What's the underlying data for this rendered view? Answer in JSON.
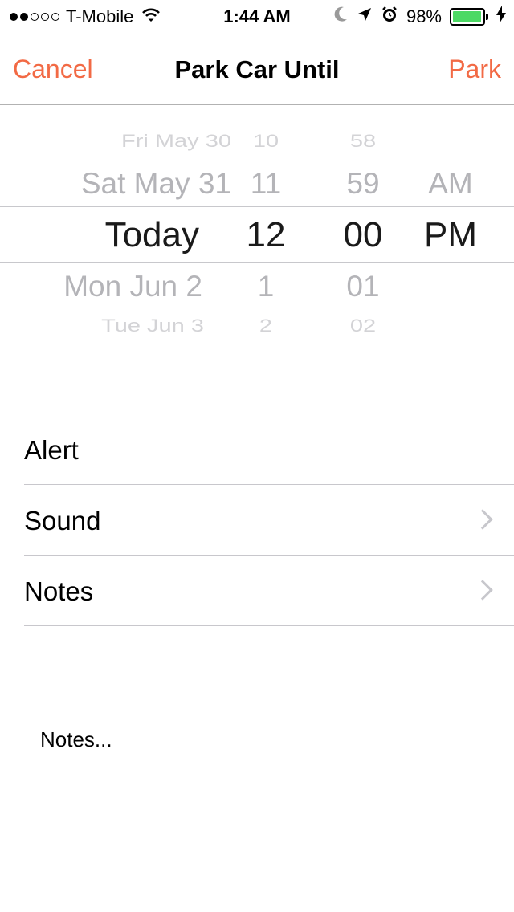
{
  "status_bar": {
    "carrier": "T-Mobile",
    "time": "1:44 AM",
    "battery_percent": "98%",
    "battery_level": 0.98,
    "signal_bars_filled": 2,
    "signal_bars_total": 5,
    "icons": [
      "wifi-icon",
      "moon-icon",
      "location-arrow-icon",
      "alarm-icon",
      "battery-icon",
      "charging-bolt-icon"
    ],
    "battery_color": "#4cd964"
  },
  "nav": {
    "cancel_label": "Cancel",
    "title": "Park Car Until",
    "park_label": "Park",
    "accent_color": "#f26a45"
  },
  "picker": {
    "dates": [
      "Fri May 30",
      "Sat May 31",
      "Today",
      "Mon Jun 2",
      "Tue Jun 3"
    ],
    "hours": [
      "10",
      "11",
      "12",
      "1",
      "2"
    ],
    "minutes": [
      "58",
      "59",
      "00",
      "01",
      "02"
    ],
    "ampm": [
      "AM",
      "PM"
    ],
    "selected": {
      "date": "Today",
      "hour": "12",
      "minute": "00",
      "ampm": "PM"
    }
  },
  "settings": {
    "alert_label": "Alert",
    "sound_label": "Sound",
    "notes_label": "Notes"
  },
  "notes": {
    "placeholder": "Notes..."
  }
}
